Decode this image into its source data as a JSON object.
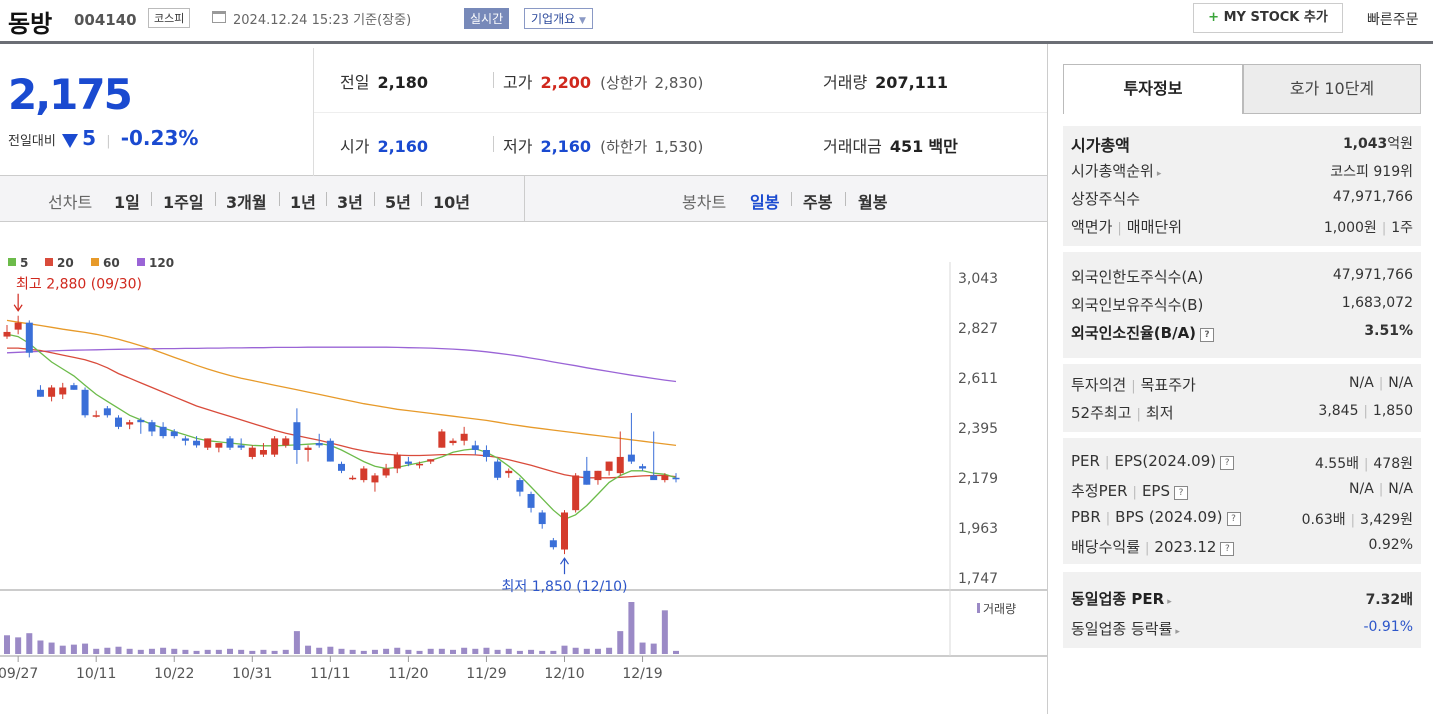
{
  "header": {
    "stock_name": "동방",
    "stock_code": "004140",
    "market": "코스피",
    "datetime": "2024.12.24 15:23 기준(장중)",
    "realtime_label": "실시간",
    "company_info_label": "기업개요",
    "mystock_label": "MY STOCK 추가",
    "quick_order_label": "빠른주문"
  },
  "price": {
    "current": "2,175",
    "change_label": "전일대비",
    "change_amount": "5",
    "change_pct": "-0.23%",
    "prev_label": "전일",
    "prev": "2,180",
    "high_label": "고가",
    "high": "2,200",
    "upper_limit_label": "(상한가",
    "upper_limit": "2,830)",
    "volume_label": "거래량",
    "volume": "207,111",
    "open_label": "시가",
    "open": "2,160",
    "low_label": "저가",
    "low": "2,160",
    "lower_limit_label": "(하한가",
    "lower_limit": "1,530)",
    "amount_label": "거래대금",
    "amount": "451",
    "amount_unit": "백만",
    "down_color": "#1a4ad0",
    "up_color": "#d0281d"
  },
  "period_bar": {
    "line_chart_label": "선차트",
    "line_periods": [
      "1일",
      "1주일",
      "3개월",
      "1년",
      "3년",
      "5년",
      "10년"
    ],
    "candle_chart_label": "봉차트",
    "candle_periods": [
      "일봉",
      "주봉",
      "월봉"
    ],
    "active_candle": "일봉"
  },
  "right_panel": {
    "tabs": [
      "투자정보",
      "호가 10단계"
    ],
    "active_tab": "투자정보",
    "market_cap": {
      "label": "시가총액",
      "value": "1,043",
      "unit": "억원"
    },
    "market_cap_rank": {
      "label": "시가총액순위",
      "value": "코스피 919위"
    },
    "shares": {
      "label": "상장주식수",
      "value": "47,971,766"
    },
    "par_unit": {
      "label1": "액면가",
      "label2": "매매단위",
      "value1": "1,000원",
      "value2": "1주"
    },
    "foreign_limit": {
      "label": "외국인한도주식수(A)",
      "value": "47,971,766"
    },
    "foreign_hold": {
      "label": "외국인보유주식수(B)",
      "value": "1,683,072"
    },
    "foreign_ratio": {
      "label": "외국인소진율(B/A)",
      "value": "3.51%"
    },
    "opinion": {
      "label1": "투자의견",
      "label2": "목표주가",
      "value1": "N/A",
      "value2": "N/A"
    },
    "week52": {
      "label1": "52주최고",
      "label2": "최저",
      "value1": "3,845",
      "value2": "1,850"
    },
    "per_eps": {
      "label1": "PER",
      "label2": "EPS(2024.09)",
      "value1": "4.55배",
      "value2": "478원"
    },
    "est_per_eps": {
      "label1": "추정PER",
      "label2": "EPS",
      "value1": "N/A",
      "value2": "N/A"
    },
    "pbr_bps": {
      "label1": "PBR",
      "label2": "BPS (2024.09)",
      "value1": "0.63배",
      "value2": "3,429원"
    },
    "dividend": {
      "label1": "배당수익률",
      "label2": "2023.12",
      "value": "0.92%"
    },
    "sector_per": {
      "label": "동일업종 PER",
      "value": "7.32배"
    },
    "sector_change": {
      "label": "동일업종 등락률",
      "value": "-0.91%"
    }
  },
  "chart_data": {
    "type": "candlestick",
    "legend": [
      {
        "name": "5",
        "color": "#6cbb4a"
      },
      {
        "name": "20",
        "color": "#d94b3b"
      },
      {
        "name": "60",
        "color": "#e79a2a"
      },
      {
        "name": "120",
        "color": "#9a64d6"
      }
    ],
    "y_ticks": [
      "3,043",
      "2,827",
      "2,611",
      "2,395",
      "2,179",
      "1,963",
      "1,747"
    ],
    "y_range": [
      1747,
      3043
    ],
    "x_ticks": [
      {
        "label": "09/27",
        "index": 1
      },
      {
        "label": "10/11",
        "index": 8
      },
      {
        "label": "10/22",
        "index": 15
      },
      {
        "label": "10/31",
        "index": 22
      },
      {
        "label": "11/11",
        "index": 29
      },
      {
        "label": "11/20",
        "index": 36
      },
      {
        "label": "11/29",
        "index": 43
      },
      {
        "label": "12/10",
        "index": 50
      },
      {
        "label": "12/19",
        "index": 57
      }
    ],
    "high_annotation": "최고 2,880 (09/30)",
    "low_annotation": "최저 1,850 (12/10)",
    "volume_label": "거래량",
    "candles": [
      {
        "o": 2790,
        "h": 2840,
        "l": 2780,
        "c": 2810
      },
      {
        "o": 2820,
        "h": 2880,
        "l": 2800,
        "c": 2850
      },
      {
        "o": 2850,
        "h": 2860,
        "l": 2700,
        "c": 2720
      },
      {
        "o": 2560,
        "h": 2580,
        "l": 2530,
        "c": 2530
      },
      {
        "o": 2530,
        "h": 2580,
        "l": 2510,
        "c": 2570
      },
      {
        "o": 2540,
        "h": 2590,
        "l": 2520,
        "c": 2570
      },
      {
        "o": 2580,
        "h": 2590,
        "l": 2560,
        "c": 2560
      },
      {
        "o": 2560,
        "h": 2570,
        "l": 2440,
        "c": 2450
      },
      {
        "o": 2450,
        "h": 2470,
        "l": 2440,
        "c": 2450
      },
      {
        "o": 2480,
        "h": 2490,
        "l": 2440,
        "c": 2450
      },
      {
        "o": 2440,
        "h": 2450,
        "l": 2390,
        "c": 2400
      },
      {
        "o": 2410,
        "h": 2430,
        "l": 2390,
        "c": 2420
      },
      {
        "o": 2430,
        "h": 2440,
        "l": 2370,
        "c": 2420
      },
      {
        "o": 2420,
        "h": 2430,
        "l": 2360,
        "c": 2380
      },
      {
        "o": 2400,
        "h": 2420,
        "l": 2350,
        "c": 2360
      },
      {
        "o": 2380,
        "h": 2390,
        "l": 2350,
        "c": 2360
      },
      {
        "o": 2350,
        "h": 2360,
        "l": 2320,
        "c": 2340
      },
      {
        "o": 2340,
        "h": 2360,
        "l": 2310,
        "c": 2320
      },
      {
        "o": 2310,
        "h": 2350,
        "l": 2300,
        "c": 2350
      },
      {
        "o": 2310,
        "h": 2330,
        "l": 2290,
        "c": 2330
      },
      {
        "o": 2350,
        "h": 2360,
        "l": 2300,
        "c": 2310
      },
      {
        "o": 2320,
        "h": 2350,
        "l": 2300,
        "c": 2310
      },
      {
        "o": 2270,
        "h": 2320,
        "l": 2260,
        "c": 2310
      },
      {
        "o": 2280,
        "h": 2330,
        "l": 2270,
        "c": 2300
      },
      {
        "o": 2280,
        "h": 2360,
        "l": 2270,
        "c": 2350
      },
      {
        "o": 2320,
        "h": 2360,
        "l": 2310,
        "c": 2350
      },
      {
        "o": 2420,
        "h": 2480,
        "l": 2240,
        "c": 2300
      },
      {
        "o": 2300,
        "h": 2320,
        "l": 2250,
        "c": 2310
      },
      {
        "o": 2330,
        "h": 2370,
        "l": 2310,
        "c": 2320
      },
      {
        "o": 2340,
        "h": 2350,
        "l": 2250,
        "c": 2250
      },
      {
        "o": 2240,
        "h": 2250,
        "l": 2200,
        "c": 2210
      },
      {
        "o": 2180,
        "h": 2190,
        "l": 2170,
        "c": 2180
      },
      {
        "o": 2170,
        "h": 2230,
        "l": 2160,
        "c": 2220
      },
      {
        "o": 2160,
        "h": 2200,
        "l": 2120,
        "c": 2190
      },
      {
        "o": 2190,
        "h": 2240,
        "l": 2180,
        "c": 2220
      },
      {
        "o": 2220,
        "h": 2290,
        "l": 2200,
        "c": 2280
      },
      {
        "o": 2250,
        "h": 2270,
        "l": 2230,
        "c": 2240
      },
      {
        "o": 2240,
        "h": 2250,
        "l": 2220,
        "c": 2240
      },
      {
        "o": 2250,
        "h": 2260,
        "l": 2240,
        "c": 2260
      },
      {
        "o": 2310,
        "h": 2390,
        "l": 2310,
        "c": 2380
      },
      {
        "o": 2330,
        "h": 2350,
        "l": 2320,
        "c": 2340
      },
      {
        "o": 2340,
        "h": 2400,
        "l": 2320,
        "c": 2370
      },
      {
        "o": 2320,
        "h": 2340,
        "l": 2280,
        "c": 2300
      },
      {
        "o": 2300,
        "h": 2320,
        "l": 2250,
        "c": 2270
      },
      {
        "o": 2250,
        "h": 2260,
        "l": 2170,
        "c": 2180
      },
      {
        "o": 2200,
        "h": 2220,
        "l": 2180,
        "c": 2210
      },
      {
        "o": 2170,
        "h": 2180,
        "l": 2100,
        "c": 2120
      },
      {
        "o": 2110,
        "h": 2120,
        "l": 2030,
        "c": 2050
      },
      {
        "o": 2030,
        "h": 2040,
        "l": 1960,
        "c": 1980
      },
      {
        "o": 1910,
        "h": 1920,
        "l": 1870,
        "c": 1880
      },
      {
        "o": 1870,
        "h": 2040,
        "l": 1850,
        "c": 2030
      },
      {
        "o": 2040,
        "h": 2200,
        "l": 2030,
        "c": 2190
      },
      {
        "o": 2210,
        "h": 2270,
        "l": 2150,
        "c": 2150
      },
      {
        "o": 2170,
        "h": 2210,
        "l": 2150,
        "c": 2210
      },
      {
        "o": 2210,
        "h": 2250,
        "l": 2190,
        "c": 2250
      },
      {
        "o": 2200,
        "h": 2380,
        "l": 2190,
        "c": 2270
      },
      {
        "o": 2280,
        "h": 2460,
        "l": 2240,
        "c": 2250
      },
      {
        "o": 2230,
        "h": 2240,
        "l": 2210,
        "c": 2220
      },
      {
        "o": 2190,
        "h": 2380,
        "l": 2180,
        "c": 2170
      },
      {
        "o": 2170,
        "h": 2200,
        "l": 2160,
        "c": 2190
      },
      {
        "o": 2180,
        "h": 2200,
        "l": 2160,
        "c": 2175
      }
    ],
    "volumes": [
      18,
      16,
      20,
      13,
      11,
      8,
      9,
      10,
      5,
      6,
      7,
      5,
      4,
      5,
      6,
      5,
      4,
      3,
      4,
      4,
      5,
      4,
      3,
      4,
      3,
      4,
      22,
      8,
      6,
      7,
      5,
      4,
      3,
      4,
      5,
      6,
      4,
      3,
      5,
      5,
      4,
      6,
      5,
      6,
      4,
      5,
      3,
      4,
      3,
      3,
      8,
      6,
      5,
      5,
      6,
      22,
      50,
      11,
      10,
      42,
      3
    ],
    "ma5": [
      2800,
      2790,
      2760,
      2720,
      2680,
      2650,
      2620,
      2580,
      2540,
      2510,
      2480,
      2450,
      2430,
      2410,
      2395,
      2380,
      2365,
      2350,
      2340,
      2335,
      2330,
      2325,
      2320,
      2318,
      2318,
      2320,
      2322,
      2325,
      2328,
      2320,
      2300,
      2275,
      2250,
      2230,
      2220,
      2225,
      2235,
      2245,
      2255,
      2270,
      2290,
      2300,
      2305,
      2290,
      2265,
      2230,
      2190,
      2140,
      2090,
      2040,
      2000,
      2020,
      2060,
      2110,
      2160,
      2190,
      2210,
      2210,
      2200,
      2195,
      2180
    ],
    "ma20": [
      2740,
      2740,
      2735,
      2730,
      2720,
      2710,
      2700,
      2690,
      2675,
      2655,
      2630,
      2610,
      2590,
      2570,
      2550,
      2530,
      2510,
      2490,
      2475,
      2460,
      2445,
      2430,
      2415,
      2400,
      2385,
      2372,
      2362,
      2352,
      2342,
      2330,
      2318,
      2306,
      2296,
      2288,
      2282,
      2278,
      2276,
      2276,
      2278,
      2280,
      2280,
      2280,
      2279,
      2275,
      2268,
      2258,
      2246,
      2234,
      2220,
      2206,
      2193,
      2185,
      2180,
      2180,
      2180,
      2182,
      2185,
      2188,
      2190,
      2190,
      2185
    ],
    "ma60": [
      2860,
      2852,
      2845,
      2838,
      2830,
      2822,
      2815,
      2808,
      2800,
      2790,
      2778,
      2765,
      2750,
      2735,
      2718,
      2700,
      2683,
      2666,
      2650,
      2635,
      2622,
      2610,
      2600,
      2590,
      2580,
      2570,
      2560,
      2550,
      2540,
      2530,
      2520,
      2510,
      2500,
      2492,
      2484,
      2476,
      2470,
      2464,
      2458,
      2452,
      2446,
      2440,
      2434,
      2428,
      2420,
      2412,
      2405,
      2398,
      2392,
      2386,
      2380,
      2374,
      2368,
      2362,
      2356,
      2350,
      2344,
      2338,
      2332,
      2326,
      2320
    ],
    "ma120": [
      2720,
      2722,
      2724,
      2726,
      2728,
      2730,
      2731,
      2732,
      2733,
      2734,
      2735,
      2736,
      2737,
      2737,
      2738,
      2738,
      2739,
      2739,
      2740,
      2740,
      2741,
      2741,
      2742,
      2742,
      2743,
      2743,
      2743,
      2744,
      2744,
      2744,
      2744,
      2744,
      2744,
      2744,
      2744,
      2743,
      2742,
      2741,
      2740,
      2738,
      2736,
      2733,
      2729,
      2724,
      2718,
      2712,
      2705,
      2697,
      2689,
      2680,
      2672,
      2664,
      2655,
      2647,
      2639,
      2631,
      2623,
      2616,
      2609,
      2602,
      2596
    ]
  }
}
